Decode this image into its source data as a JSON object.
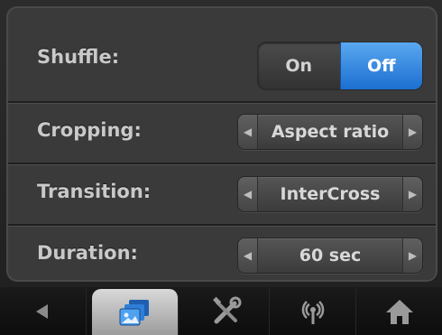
{
  "settings": {
    "shuffle": {
      "label": "Shuffle:",
      "on_label": "On",
      "off_label": "Off",
      "selected": "Off"
    },
    "cropping": {
      "label": "Cropping:",
      "value": "Aspect ratio"
    },
    "transition": {
      "label": "Transition:",
      "value": "InterCross"
    },
    "duration": {
      "label": "Duration:",
      "value": "60 sec"
    }
  },
  "tabbar": {
    "tabs": [
      {
        "icon": "back-arrow-icon",
        "active": false
      },
      {
        "icon": "slideshow-icon",
        "active": true
      },
      {
        "icon": "tools-icon",
        "active": false
      },
      {
        "icon": "wireless-icon",
        "active": false
      },
      {
        "icon": "home-icon",
        "active": false
      }
    ]
  },
  "colors": {
    "accent": "#2a82e0",
    "panel": "#3a3a3a",
    "label": "#c9c9c9"
  }
}
